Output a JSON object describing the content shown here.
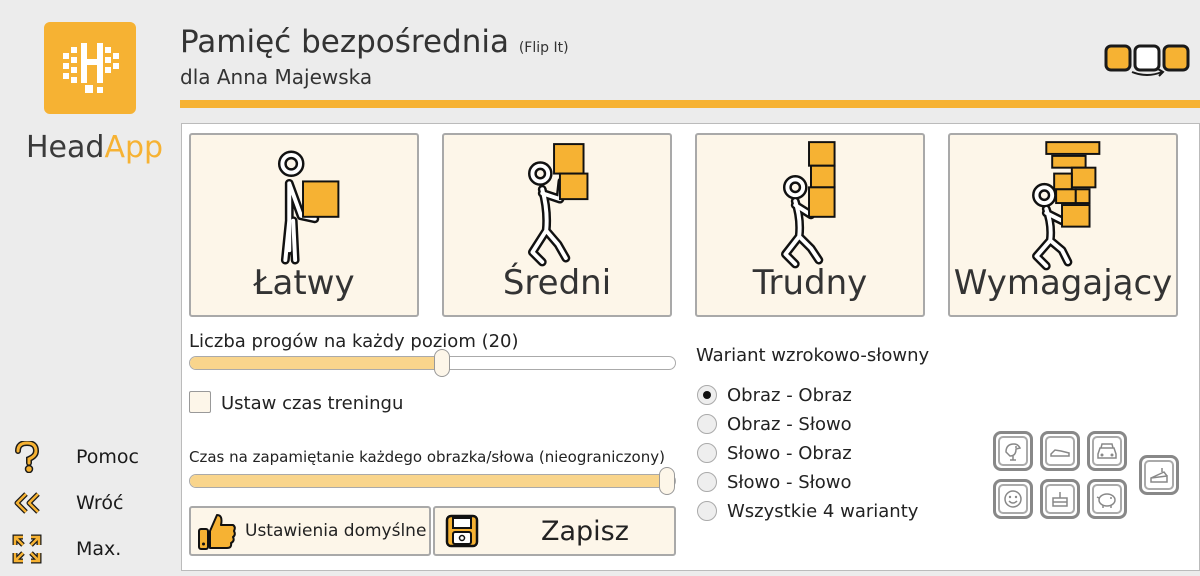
{
  "brand": {
    "head": "Head",
    "app": "App",
    "accent": "#f6b233"
  },
  "header": {
    "title": "Pamięć bezpośrednia",
    "title_sub": "(Flip It)",
    "subtitle": "dla Anna Majewska"
  },
  "sidebar": {
    "help": "Pomoc",
    "back": "Wróć",
    "max": "Max."
  },
  "levels": [
    {
      "label": "Łatwy",
      "icon": "person-carrying-one-box-icon"
    },
    {
      "label": "Średni",
      "icon": "person-carrying-two-boxes-icon"
    },
    {
      "label": "Trudny",
      "icon": "person-carrying-three-boxes-icon"
    },
    {
      "label": "Wymagający",
      "icon": "person-carrying-many-boxes-icon"
    }
  ],
  "settings": {
    "thresholds_label": "Liczba progów na każdy poziom (20)",
    "thresholds_fraction": 0.52,
    "training_time_label": "Ustaw czas treningu",
    "memorize_time_label": "Czas na zapamiętanie każdego obrazka/słowa (nieograniczony)",
    "memorize_fraction": 1.0,
    "defaults_button": "Ustawienia domyślne",
    "save_button": "Zapisz"
  },
  "variant": {
    "title": "Wariant wzrokowo-słowny",
    "options": [
      "Obraz - Obraz",
      "Obraz - Słowo",
      "Słowo - Obraz",
      "Słowo - Słowo",
      "Wszystkie 4 warianty"
    ],
    "selected": "Obraz - Obraz"
  },
  "categories": [
    "bird-icon",
    "shoe-icon",
    "car-icon",
    "cake-icon",
    "smiley-icon",
    "cake-icon",
    "piggy-bank-icon"
  ]
}
